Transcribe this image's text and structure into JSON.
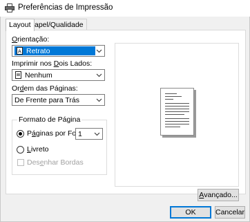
{
  "window": {
    "title": "Preferências de Impressão",
    "icon": "printer-icon"
  },
  "tabs": [
    {
      "label": "Layout",
      "active": true
    },
    {
      "label": "Papel/Qualidade",
      "active": false
    }
  ],
  "orientation": {
    "label_u": "O",
    "label_rest": "rientação:",
    "value": "Retrato",
    "icon": "portrait-page-icon"
  },
  "duplex": {
    "label_pre": "Imprimir nos ",
    "label_u": "D",
    "label_rest": "ois Lados:",
    "value": "Nenhum",
    "icon": "single-page-icon"
  },
  "page_order": {
    "label_pre": "Or",
    "label_u": "d",
    "label_rest": "em das Páginas:",
    "value": "De Frente para Trás"
  },
  "page_format": {
    "title": "Formato de Página",
    "pages_per_sheet": {
      "label_pre": "P",
      "label_u": "á",
      "label_rest": "ginas por Folha",
      "value": "1",
      "selected": true
    },
    "booklet": {
      "label_u": "L",
      "label_rest": "ivreto",
      "selected": false
    },
    "draw_borders": {
      "label_pre": "Des",
      "label_u": "e",
      "label_rest": "nhar Bordas",
      "checked": false,
      "disabled": true
    }
  },
  "buttons": {
    "advanced": {
      "label_u": "A",
      "label_rest": "vançado..."
    },
    "ok": "OK",
    "cancel": "Cancelar"
  },
  "colors": {
    "selection": "#0078d7",
    "dialog_bg": "#f0f0f0"
  }
}
